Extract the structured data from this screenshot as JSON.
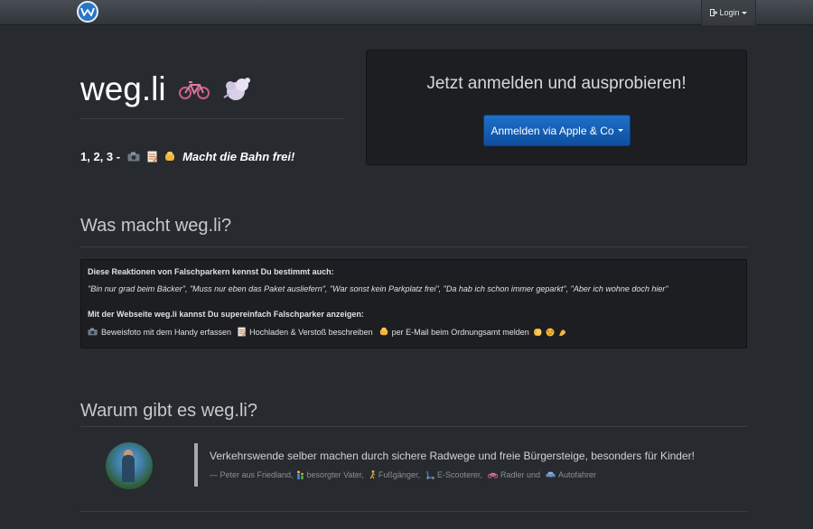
{
  "navbar": {
    "logo_icon": "wegli-logo-icon",
    "login_label": "Login",
    "login_icon": "sign-in-icon"
  },
  "hero": {
    "title": "weg.li",
    "title_icons": [
      "bicycle-icon",
      "cloud-puff-icon"
    ],
    "tagline_prefix": "1, 2, 3 -",
    "tagline_icons": [
      "camera-icon",
      "memo-icon",
      "fist-icon"
    ],
    "tagline_emphasis": "Macht die Bahn frei!"
  },
  "signup": {
    "heading": "Jetzt anmelden und ausprobieren!",
    "button_label": "Anmelden via Apple & Co"
  },
  "what": {
    "title": "Was macht weg.li?",
    "reactions_heading": "Diese Reaktionen von Falschparkern kennst Du bestimmt auch:",
    "reactions_quotes": "\"Bin nur grad beim Bäcker\", \"Muss nur eben das Paket ausliefern\", \"War sonst kein Parkplatz frei\", \"Da hab ich schon immer geparkt\", \"Aber ich wohne doch hier\"",
    "website_heading": "Mit der Webseite weg.li kannst Du supereinfach Falschparker anzeigen:",
    "steps": [
      {
        "icon": "camera-icon",
        "text": "Beweisfoto mit dem Handy erfassen"
      },
      {
        "icon": "memo-icon",
        "text": "Hochladen & Verstoß beschreiben"
      },
      {
        "icon": "fist-icon",
        "text": "per E-Mail beim Ordnungsamt melden"
      }
    ],
    "trailing_icons": [
      "clapping-hands-icon",
      "star-struck-icon",
      "flexed-biceps-icon"
    ]
  },
  "why": {
    "title": "Warum gibt es weg.li?",
    "avatar_icon": "avatar",
    "quote": "Verkehrswende selber machen durch sichere Radwege und freie Bürgersteige, besonders für Kinder!",
    "footer_prefix": "— Peter aus Friedland,",
    "footer_items": [
      {
        "icon": "family-icon",
        "text": "besorgter Vater,"
      },
      {
        "icon": "pedestrian-icon",
        "text": "Fußgänger,"
      },
      {
        "icon": "scooter-icon",
        "text": "E-Scooterer,"
      },
      {
        "icon": "bicycle-icon",
        "text": "Radler und"
      },
      {
        "icon": "car-icon",
        "text": "Autofahrer"
      }
    ]
  },
  "colors": {
    "background": "#272b30",
    "navbar": "#3a3f44",
    "panel": "#1c1e22",
    "primary_button": "#1565c0"
  }
}
